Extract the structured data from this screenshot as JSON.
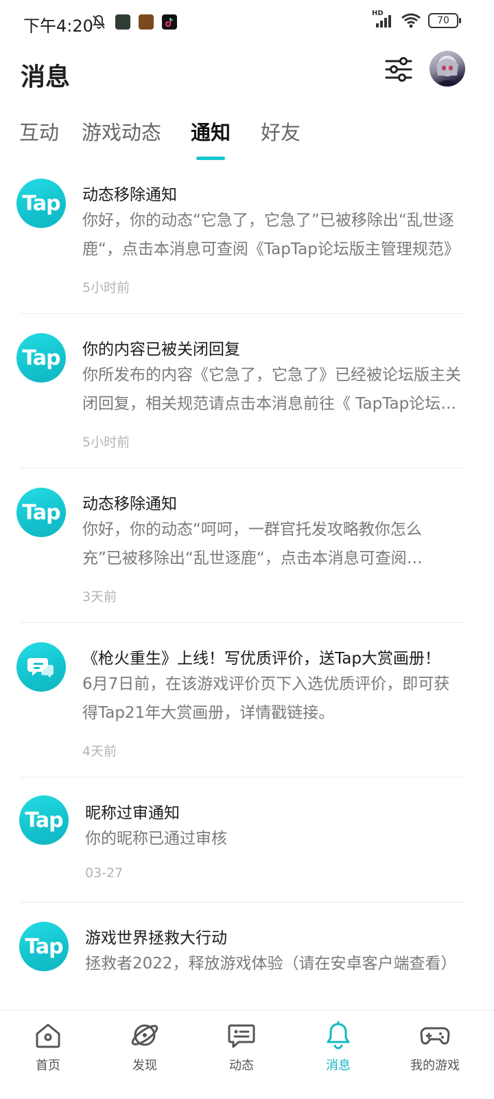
{
  "status_bar": {
    "time": "下午4:20",
    "network_badge": "HD",
    "battery": "70",
    "icons": [
      "mute-icon",
      "app-icon-1",
      "app-icon-2",
      "tiktok-icon",
      "signal-icon",
      "wifi-icon",
      "battery-icon"
    ]
  },
  "header": {
    "title": "消息"
  },
  "tabs": [
    {
      "label": "互动",
      "active": false
    },
    {
      "label": "游戏动态",
      "active": false
    },
    {
      "label": "通知",
      "active": true
    },
    {
      "label": "好友",
      "active": false
    }
  ],
  "notifications": [
    {
      "avatar_text": "Tap",
      "title": "动态移除通知",
      "body": "你好，你的动态“它急了，它急了”已被移除出“乱世逐鹿“，点击本消息可查阅《TapTap论坛版主管理规范》",
      "time": "5小时前"
    },
    {
      "avatar_text": "Tap",
      "title": "你的内容已被关闭回复",
      "body": "你所发布的内容《它急了，它急了》已经被论坛版主关闭回复，相关规范请点击本消息前往《 TapTap论坛版主管理规范》",
      "time": "5小时前"
    },
    {
      "avatar_text": "Tap",
      "title": "动态移除通知",
      "body": "你好，你的动态“呵呵，一群官托发攻略教你怎么充”已被移除出“乱世逐鹿“，点击本消息可查阅《TapTap论坛版主管理规范》",
      "time": "3天前"
    },
    {
      "avatar_text": "",
      "title": "《枪火重生》上线！写优质评价，送Tap大赏画册！",
      "body": "6月7日前，在该游戏评价页下入选优质评价，即可获得Tap21年大赏画册，详情戳链接。",
      "time": "4天前"
    },
    {
      "avatar_text": "Tap",
      "title": "昵称过审通知",
      "body": "你的昵称已通过审核",
      "time": "03-27"
    },
    {
      "avatar_text": "Tap",
      "title": "游戏世界拯救大行动",
      "body": "拯救者2022，释放游戏体验（请在安卓客户端查看）",
      "time": ""
    }
  ],
  "bottom_nav": [
    {
      "label": "首页",
      "icon": "home-icon",
      "active": false
    },
    {
      "label": "发现",
      "icon": "discover-icon",
      "active": false
    },
    {
      "label": "动态",
      "icon": "feed-icon",
      "active": false
    },
    {
      "label": "消息",
      "icon": "bell-icon",
      "active": true
    },
    {
      "label": "我的游戏",
      "icon": "gamepad-icon",
      "active": false
    }
  ],
  "colors": {
    "accent": "#15c5ce",
    "tap_logo": "#13c2cd",
    "text_primary": "#1b1b1b",
    "text_secondary": "#7a7a7a",
    "text_time": "#b3b3b3"
  }
}
